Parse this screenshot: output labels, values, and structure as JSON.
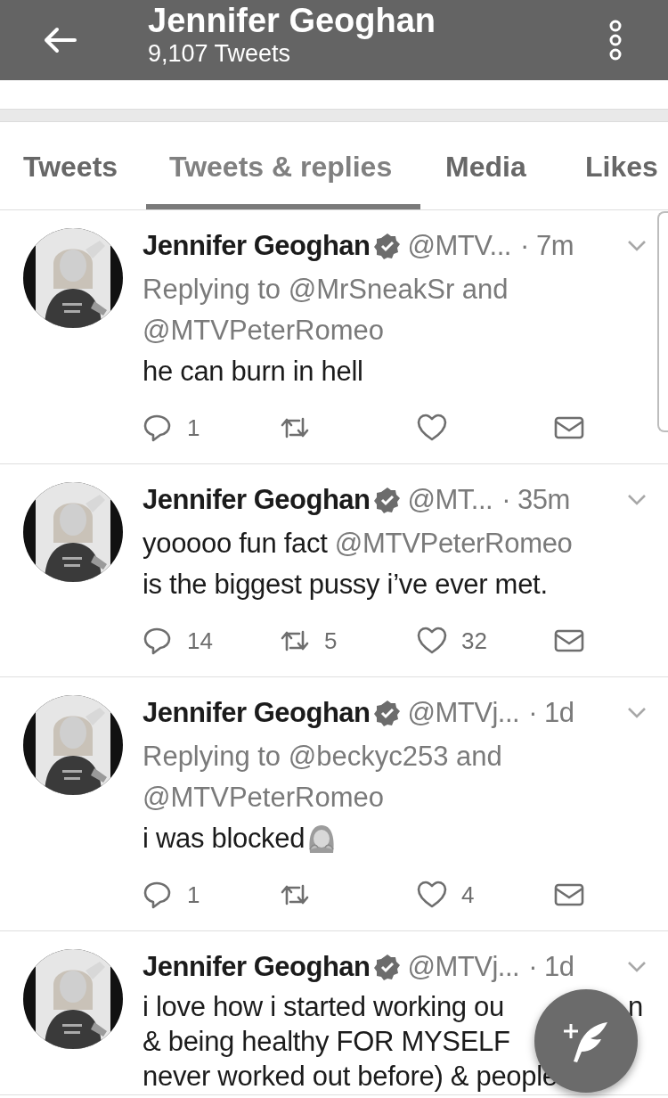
{
  "header": {
    "title": "Jennifer Geoghan",
    "subtitle": "9,107 Tweets"
  },
  "tabs": [
    {
      "label": "Tweets",
      "selected": false
    },
    {
      "label": "Tweets & replies",
      "selected": true
    },
    {
      "label": "Media",
      "selected": false
    },
    {
      "label": "Likes",
      "selected": false
    }
  ],
  "tweets": [
    {
      "name": "Jennifer Geoghan",
      "verified": true,
      "handle": "@MTV...",
      "time": "· 7m",
      "reply_to": [
        "Replying to @MrSneakSr and",
        "@MTVPeterRomeo"
      ],
      "body": [
        [
          {
            "kind": "text",
            "text": "he can burn in hell"
          }
        ]
      ],
      "actions": {
        "replies": "1"
      }
    },
    {
      "name": "Jennifer Geoghan",
      "verified": true,
      "handle": "@MT...",
      "time": "· 35m",
      "body": [
        [
          {
            "kind": "text",
            "text": "yooooo fun fact "
          },
          {
            "kind": "mention",
            "text": "@MTVPeterRomeo"
          }
        ],
        [
          {
            "kind": "text",
            "text": "is the biggest pussy i’ve ever met."
          }
        ]
      ],
      "actions": {
        "replies": "14",
        "retweets": "5",
        "likes": "32"
      }
    },
    {
      "name": "Jennifer Geoghan",
      "verified": true,
      "handle": "@MTVj...",
      "time": "· 1d",
      "reply_to": [
        "Replying to @beckyc253 and",
        "@MTVPeterRomeo"
      ],
      "body": [
        [
          {
            "kind": "text",
            "text": "i was blocked"
          },
          {
            "kind": "emoji"
          }
        ]
      ],
      "actions": {
        "replies": "1",
        "likes": "4"
      }
    },
    {
      "name": "Jennifer Geoghan",
      "verified": true,
      "handle": "@MTVj...",
      "time": "· 1d",
      "body": [
        [
          {
            "kind": "text",
            "text": "i love how i started working ou"
          },
          {
            "kind": "tail",
            "text": "n"
          }
        ],
        [
          {
            "kind": "text",
            "text": "& being healthy FOR MYSELF"
          }
        ],
        [
          {
            "kind": "text",
            "text": "never worked out before) & people"
          }
        ]
      ]
    }
  ]
}
